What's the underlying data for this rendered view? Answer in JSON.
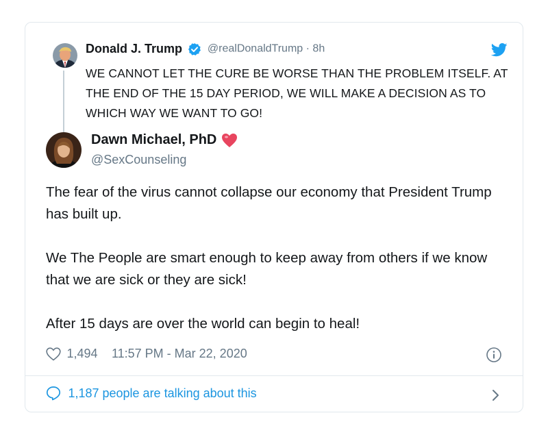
{
  "quoted_tweet": {
    "name": "Donald J. Trump",
    "handle": "@realDonaldTrump",
    "separator": "·",
    "time": "8h",
    "text": "WE CANNOT LET THE CURE BE WORSE THAN THE PROBLEM ITSELF. AT THE END OF THE 15 DAY PERIOD, WE WILL MAKE A DECISION AS TO WHICH WAY WE WANT TO GO!"
  },
  "main_tweet": {
    "name": "Dawn Michael, PhD",
    "handle": "@SexCounseling",
    "paragraphs": [
      "The fear of the virus cannot collapse our economy that President Trump has built up.",
      "We The People are smart enough to keep away from others if we know that we are sick or they are sick!",
      "After 15 days are over the world can begin to heal!"
    ],
    "likes": "1,494",
    "timestamp": "11:57 PM - Mar 22, 2020"
  },
  "footer": {
    "talking_label": "1,187 people are talking about this"
  },
  "colors": {
    "accent": "#1da1f2",
    "link": "#1b95e0",
    "muted": "#657786",
    "border": "#e1e8ed",
    "heart": "#e0245e"
  },
  "icons": [
    "verified-badge-icon",
    "twitter-bird-icon",
    "heart-emoji-icon",
    "like-heart-icon",
    "info-icon",
    "reply-bubble-icon",
    "chevron-right-icon"
  ]
}
